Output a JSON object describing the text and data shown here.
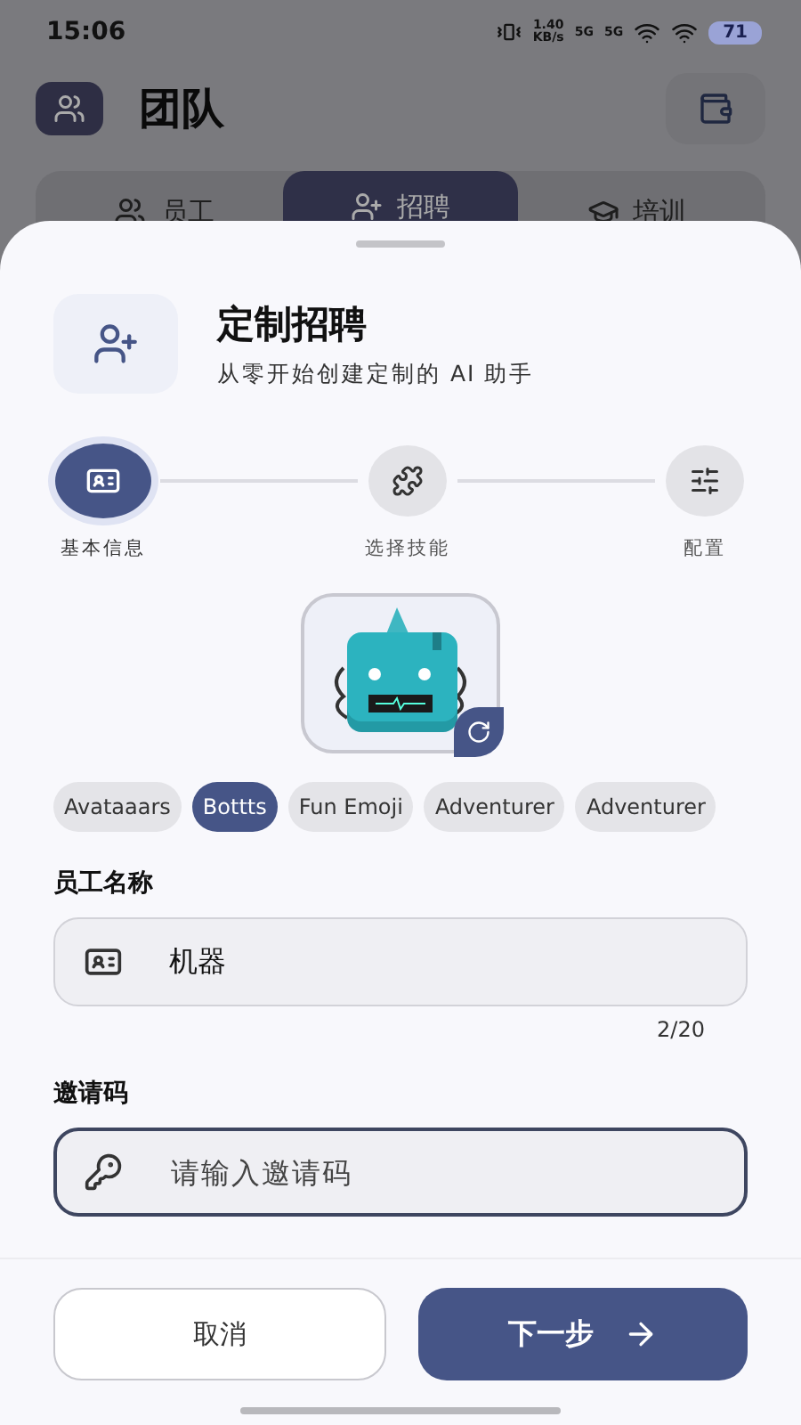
{
  "status_bar": {
    "time": "15:06",
    "speed": "1.40",
    "speed_unit": "KB/s",
    "network": [
      "5G",
      "5G"
    ],
    "battery": "71"
  },
  "header": {
    "title": "团队"
  },
  "tabs": [
    {
      "label": "员工",
      "selected": false
    },
    {
      "label": "招聘",
      "selected": true
    },
    {
      "label": "培训",
      "selected": false
    }
  ],
  "sheet": {
    "title": "定制招聘",
    "subtitle": "从零开始创建定制的 AI 助手",
    "steps": [
      {
        "label": "基本信息",
        "selected": true
      },
      {
        "label": "选择技能",
        "selected": false
      },
      {
        "label": "配置",
        "selected": false
      }
    ],
    "avatar_styles": [
      {
        "label": "Avataaars",
        "selected": false
      },
      {
        "label": "Bottts",
        "selected": true
      },
      {
        "label": "Fun Emoji",
        "selected": false
      },
      {
        "label": "Adventurer",
        "selected": false
      },
      {
        "label": "Adventurer",
        "selected": false
      }
    ],
    "fields": [
      {
        "label": "员工名称",
        "value": "机器",
        "counter": "2/20",
        "focused": false
      },
      {
        "label": "邀请码",
        "placeholder": "请输入邀请码",
        "focused": true
      }
    ],
    "buttons": {
      "cancel": "取消",
      "next": "下一步"
    }
  }
}
